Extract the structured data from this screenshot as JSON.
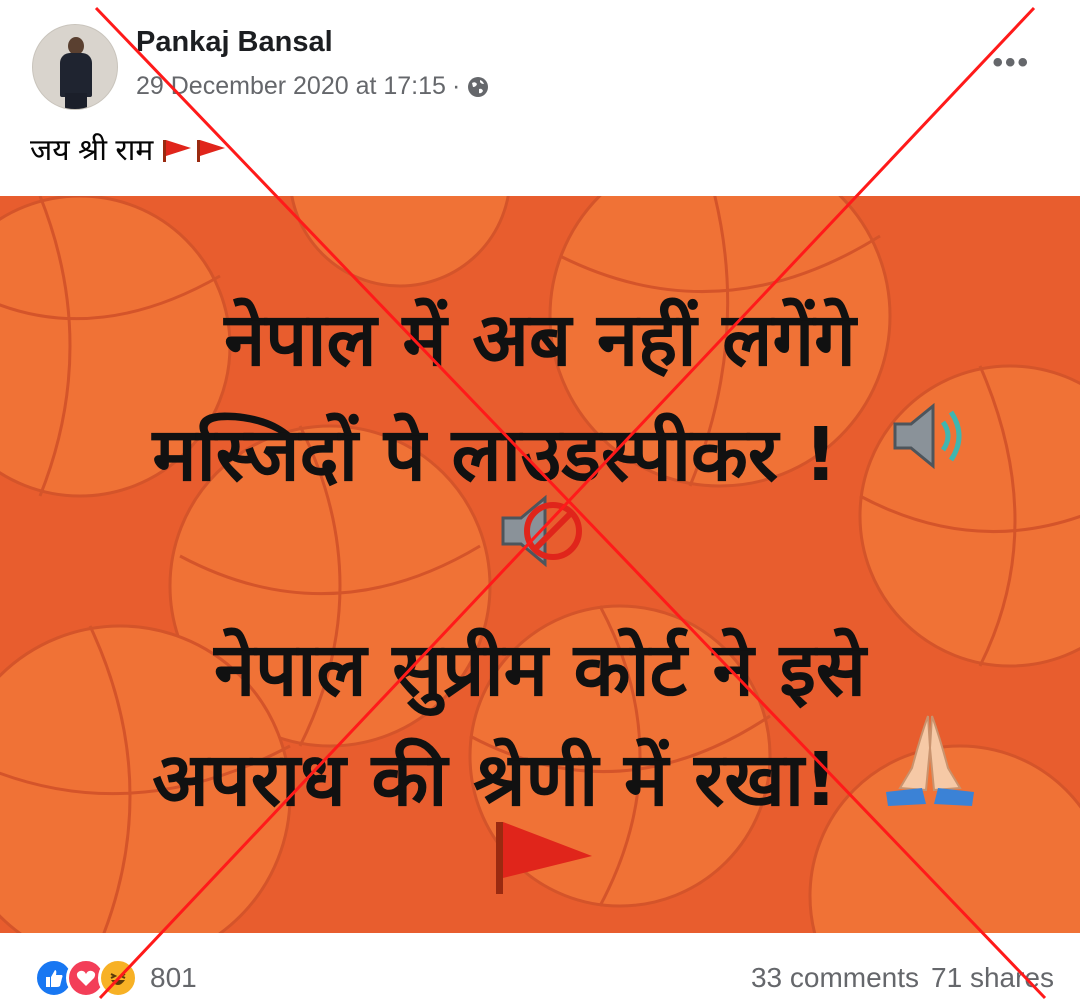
{
  "post": {
    "author": "Pankaj Bansal",
    "timestamp": "29 December 2020 at 17:15",
    "separator": "·",
    "audience_icon": "globe-icon",
    "more_label": "•••",
    "caption": "जय श्री राम"
  },
  "image": {
    "line1": "नेपाल में अब नहीं लगेंगे",
    "line2": "मस्जिदों पे लाउडस्पीकर !",
    "line3": "नेपाल सुप्रीम कोर्ट ने इसे",
    "line4": "अपराध की श्रेणी में रखा!",
    "emojis": [
      "speaker-icon",
      "muted-speaker-icon",
      "folded-hands-icon",
      "flag-icon"
    ],
    "background_color": "#e85d2e"
  },
  "footer": {
    "reaction_icons": [
      "like-icon",
      "care-icon",
      "haha-icon"
    ],
    "reaction_count": "801",
    "comments": "33 comments",
    "shares": "71 shares"
  },
  "overlay": {
    "type": "red-cross",
    "color": "#ff1a1a"
  }
}
